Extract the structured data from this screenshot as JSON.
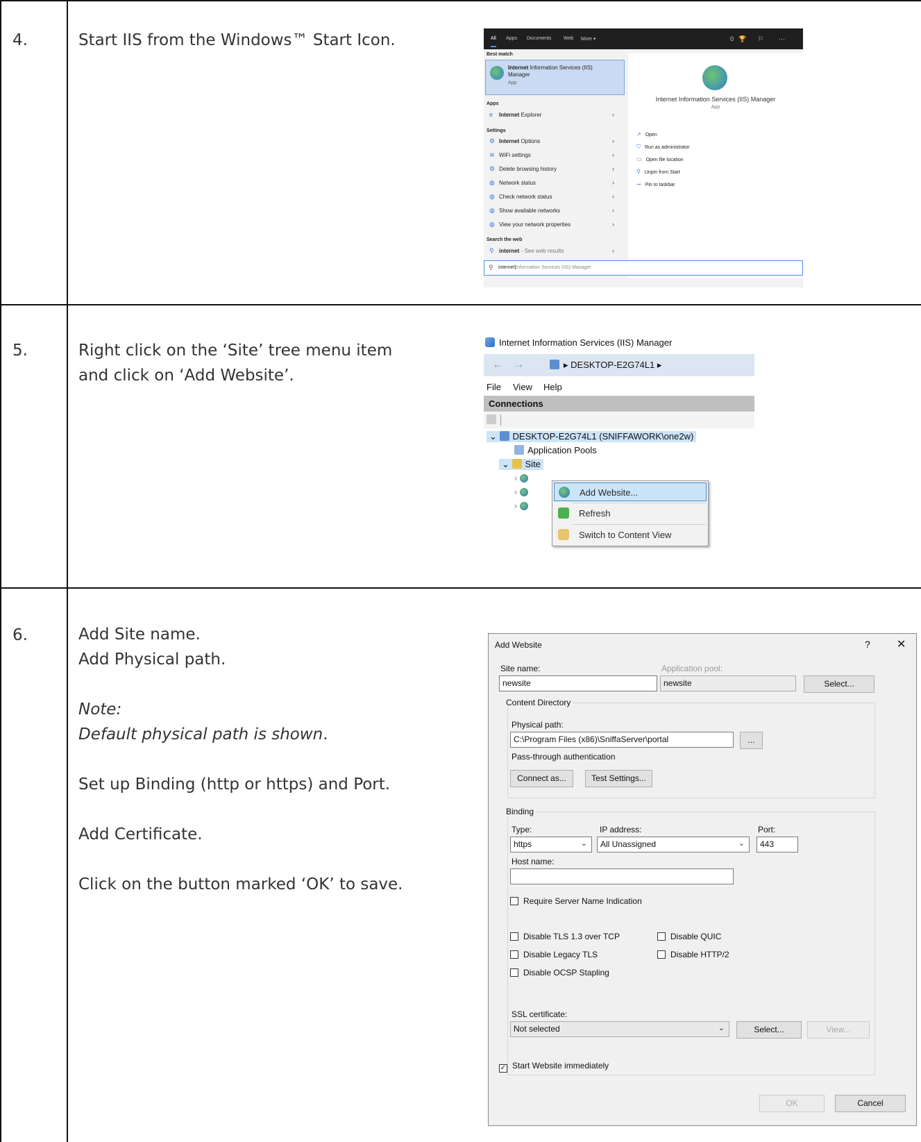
{
  "rows": [
    {
      "number": "4.",
      "lines": [
        "Start IIS from the Windows™ Start Icon."
      ]
    },
    {
      "number": "5.",
      "lines": [
        "Right click on the ‘Site’ tree menu item",
        "and click on ‘Add Website’."
      ]
    },
    {
      "number": "6.",
      "line1": "Add Site name.",
      "line2": "Add Physical path.",
      "note_label": "Note:",
      "note_text": "Default physical path is shown",
      "note_end": ".",
      "line3": "Set up Binding (http or https) and Port.",
      "line4": "Add Certificate.",
      "line5": "Click on the button marked ‘OK’ to save."
    }
  ],
  "start_search": {
    "tabs": [
      "All",
      "Apps",
      "Documents",
      "Web",
      "More ▾"
    ],
    "top_right": [
      "0",
      "⋯"
    ],
    "best_match_label": "Best match",
    "best_match": {
      "bold": "Internet",
      "rest": " Information Services (IIS)",
      "line2": "Manager",
      "kind": "App"
    },
    "apps_label": "Apps",
    "apps": [
      {
        "bold": "Internet",
        "rest": " Explorer"
      }
    ],
    "settings_label": "Settings",
    "settings": [
      {
        "bold": "Internet",
        "rest": " Options"
      },
      {
        "bold": "",
        "rest": "WiFi settings"
      },
      {
        "bold": "",
        "rest": "Delete browsing history"
      },
      {
        "bold": "",
        "rest": "Network status"
      },
      {
        "bold": "",
        "rest": "Check network status"
      },
      {
        "bold": "",
        "rest": "Show available networks"
      },
      {
        "bold": "",
        "rest": "View your network properties"
      }
    ],
    "web_label": "Search the web",
    "web_item": {
      "bold": "internet",
      "rest": " - See web results"
    },
    "detail_title": "Internet Information Services (IIS) Manager",
    "detail_kind": "App",
    "actions": [
      "Open",
      "Run as administrator",
      "Open file location",
      "Unpin from Start",
      "Pin to taskbar"
    ],
    "query": "internet",
    "query_ghost": "Information Services (IIS) Manager"
  },
  "iis": {
    "title": "Internet Information Services (IIS) Manager",
    "breadcrumb": "▸  DESKTOP-E2G74L1  ▸",
    "menu": [
      "File",
      "View",
      "Help"
    ],
    "connections": "Connections",
    "root_node": "DESKTOP-E2G74L1 (SNIFFAWORK\\one2w)",
    "app_pools": "Application Pools",
    "sites": "Site",
    "context_menu": [
      "Add Website...",
      "Refresh",
      "Switch to Content View"
    ]
  },
  "dialog": {
    "title": "Add Website",
    "help": "?",
    "close": "✕",
    "site_name_label": "Site name:",
    "site_name": "newsite",
    "app_pool_label": "Application pool:",
    "app_pool": "newsite",
    "select_btn": "Select...",
    "content_dir": "Content Directory",
    "physical_path_label": "Physical path:",
    "physical_path": "C:\\Program Files (x86)\\SniffaServer\\portal",
    "browse_btn": "...",
    "pass_through": "Pass-through authentication",
    "connect_as": "Connect as...",
    "test_settings": "Test Settings...",
    "binding": "Binding",
    "type_label": "Type:",
    "type_value": "https",
    "ip_label": "IP address:",
    "ip_value": "All Unassigned",
    "port_label": "Port:",
    "port_value": "443",
    "host_label": "Host name:",
    "host_value": "",
    "sni": "Require Server Name Indication",
    "tls13": "Disable TLS 1.3 over TCP",
    "quic": "Disable QUIC",
    "legacy_tls": "Disable Legacy TLS",
    "http2": "Disable HTTP/2",
    "ocsp": "Disable OCSP Stapling",
    "ssl_label": "SSL certificate:",
    "ssl_value": "Not selected",
    "ssl_select": "Select...",
    "ssl_view": "View...",
    "start_immediately": "Start Website immediately",
    "ok": "OK",
    "cancel": "Cancel"
  }
}
